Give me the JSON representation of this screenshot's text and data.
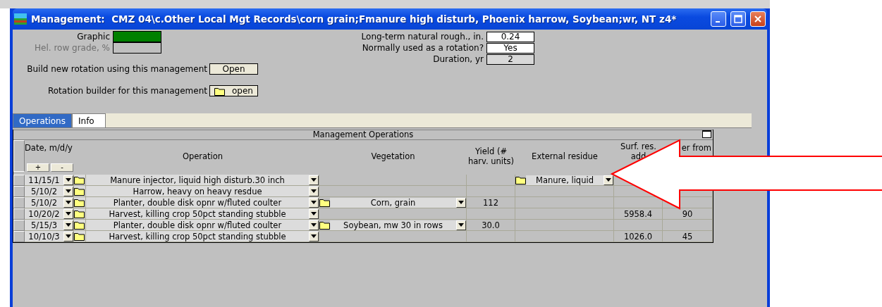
{
  "window": {
    "title": "Management:  CMZ 04\\c.Other Local Mgt Records\\corn grain;Fmanure high disturb, Phoenix harrow, Soybean;wr, NT z4*"
  },
  "form": {
    "left": [
      {
        "label": "Graphic",
        "color": "#008000",
        "disabled": false
      },
      {
        "label": "Hel. row grade, %",
        "disabled": true
      }
    ],
    "right": [
      {
        "label": "Long-term natural rough., in.",
        "value": "0.24",
        "readonly": false
      },
      {
        "label": "Normally used as a rotation?",
        "value": "Yes",
        "readonly": false
      },
      {
        "label": "Duration, yr",
        "value": "2",
        "readonly": true
      }
    ],
    "actions": [
      {
        "label": "Build new rotation using this management",
        "button": "Open",
        "folder": false
      },
      {
        "label": "Rotation builder for this management",
        "button": "open",
        "folder": true
      }
    ]
  },
  "tabs": [
    {
      "label": "Operations",
      "selected": true
    },
    {
      "label": "Info",
      "selected": false
    }
  ],
  "operations": {
    "title": "Management Operations",
    "columns": [
      "Date, m/d/y",
      "Operation",
      "Vegetation",
      "Yield (#\nharv. units)",
      "External residue",
      "Surf. res.\nadd",
      "er from"
    ],
    "date_buttons": [
      "+",
      "-"
    ],
    "rows": [
      {
        "date": "11/15/1",
        "operation": "Manure injector, liquid high disturb.30 inch",
        "external_residue": "Manure, liquid"
      },
      {
        "date": "5/10/2",
        "operation": "Harrow, heavy on heavy resdue"
      },
      {
        "date": "5/10/2",
        "operation": "Planter, double disk opnr w/fluted coulter",
        "vegetation": "Corn, grain",
        "yield": "112"
      },
      {
        "date": "10/20/2",
        "operation": "Harvest, killing crop 50pct standing stubble",
        "surf_res": "5958.4",
        "column_7": "90"
      },
      {
        "date": "5/15/3",
        "operation": "Planter, double disk opnr w/fluted coulter",
        "vegetation": "Soybean, mw 30 in rows",
        "yield": "30.0"
      },
      {
        "date": "10/10/3",
        "operation": "Harvest, killing crop 50pct standing stubble",
        "surf_res": "1026.0",
        "column_7": "45"
      }
    ]
  }
}
